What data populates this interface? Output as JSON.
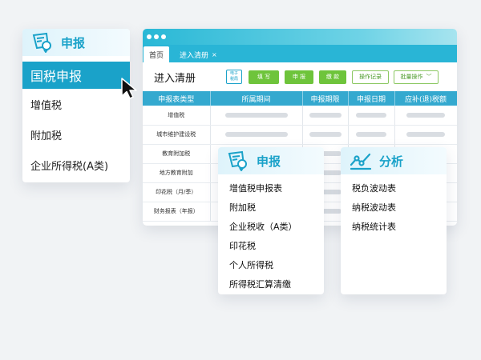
{
  "left_menu": {
    "title": "申报",
    "active_item": "国税申报",
    "items": [
      "增值税",
      "附加税",
      "企业所得税(A类)"
    ]
  },
  "window": {
    "tabs": {
      "home": "首页",
      "current": "进入清册",
      "close": "×"
    },
    "page_title": "进入清册",
    "e_icon_top": "电子",
    "e_icon_bottom": "税局",
    "buttons": {
      "fill": "填 写",
      "declare": "申 报",
      "pay": "缴 款",
      "log": "操作记录",
      "batch": "批量操作"
    },
    "columns": [
      "申报表类型",
      "所属期间",
      "申报期限",
      "申报日期",
      "应补(退)税额"
    ],
    "rows": [
      "增值税",
      "城市维护建设税",
      "教育附加税",
      "地方教育附加",
      "印花税（月/季）",
      "财务报表（年报）"
    ]
  },
  "filing_card": {
    "title": "申报",
    "items": [
      "增值税申报表",
      "附加税",
      "企业税收（A类）",
      "印花税",
      "个人所得税",
      "所得税汇算清缴"
    ]
  },
  "analysis_card": {
    "title": "分析",
    "items": [
      "税负波动表",
      "纳税波动表",
      "纳税统计表"
    ]
  },
  "colors": {
    "accent": "#1aa2c9",
    "green": "#6ec43b",
    "header": "#34a9cf"
  }
}
